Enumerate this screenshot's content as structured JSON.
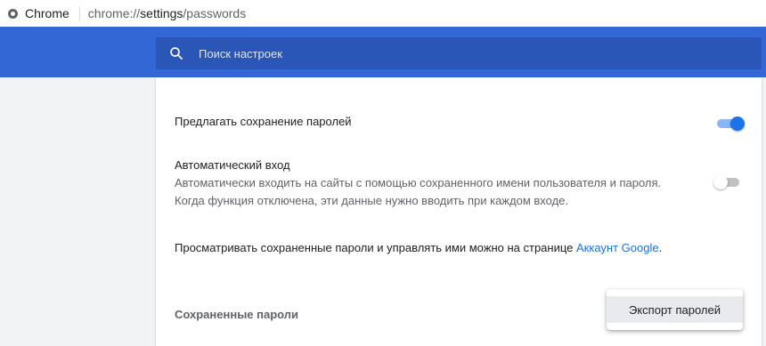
{
  "addressbar": {
    "site": "Chrome",
    "url_scheme": "chrome://",
    "url_host": "settings",
    "url_path": "/passwords"
  },
  "search": {
    "placeholder": "Поиск настроек"
  },
  "settings": {
    "offer_save_label": "Предлагать сохранение паролей",
    "offer_save_enabled": true,
    "auto_signin_title": "Автоматический вход",
    "auto_signin_desc_line1": "Автоматически входить на сайты с помощью сохраненного имени пользователя и пароля.",
    "auto_signin_desc_line2": "Когда функция отключена, эти данные нужно вводить при каждом входе.",
    "auto_signin_enabled": false,
    "manage_text": "Просматривать сохраненные пароли и управлять ими можно на странице ",
    "manage_link": "Аккаунт Google",
    "manage_suffix": ".",
    "saved_passwords_heading": "Сохраненные пароли"
  },
  "menu": {
    "export_label": "Экспорт паролей"
  },
  "colors": {
    "toolbar": "#3367d6",
    "accent": "#1a73e8"
  }
}
